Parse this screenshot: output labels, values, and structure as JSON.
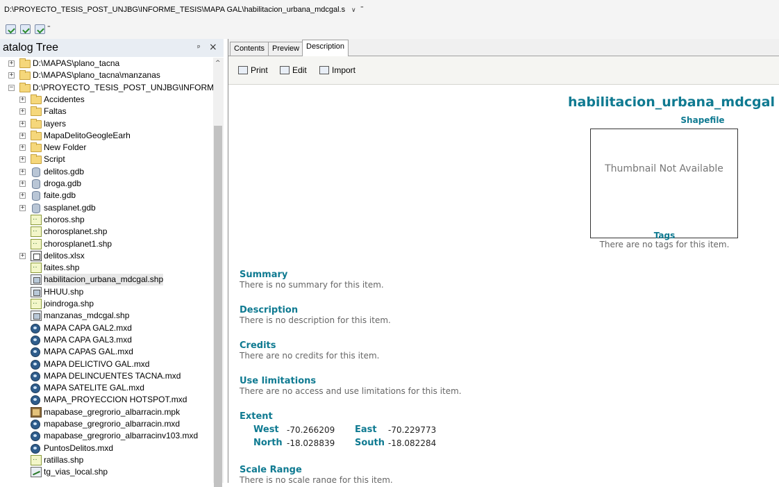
{
  "address_bar": {
    "path": "D:\\PROYECTO_TESIS_POST_UNJBG\\INFORME_TESIS\\MAPA GAL\\habilitacion_urbana_mdcgal.s",
    "dropdown": "∨",
    "more": "⁼"
  },
  "catalog": {
    "title": "atalog Tree",
    "pin": "ᵖ",
    "close": "×",
    "items": [
      {
        "label": "D:\\MAPAS\\plano_tacna",
        "expander": "+",
        "icon": "folder-icon",
        "level": 0
      },
      {
        "label": "D:\\MAPAS\\plano_tacna\\manzanas",
        "expander": "+",
        "icon": "folder-icon",
        "level": 0
      },
      {
        "label": "D:\\PROYECTO_TESIS_POST_UNJBG\\INFORME",
        "expander": "−",
        "icon": "folder-icon",
        "level": 0
      },
      {
        "label": "Accidentes",
        "expander": "+",
        "icon": "folder-icon",
        "level": 1
      },
      {
        "label": "Faltas",
        "expander": "+",
        "icon": "folder-icon",
        "level": 1
      },
      {
        "label": "layers",
        "expander": "+",
        "icon": "folder-icon",
        "level": 1
      },
      {
        "label": "MapaDelitoGeogleEarh",
        "expander": "+",
        "icon": "folder-icon",
        "level": 1
      },
      {
        "label": "New Folder",
        "expander": "+",
        "icon": "folder-icon",
        "level": 1
      },
      {
        "label": "Script",
        "expander": "+",
        "icon": "folder-icon",
        "level": 1
      },
      {
        "label": "delitos.gdb",
        "expander": "+",
        "icon": "gdb-icon",
        "level": 1
      },
      {
        "label": "droga.gdb",
        "expander": "+",
        "icon": "gdb-icon",
        "level": 1
      },
      {
        "label": "faite.gdb",
        "expander": "+",
        "icon": "gdb-icon",
        "level": 1
      },
      {
        "label": "sasplanet.gdb",
        "expander": "+",
        "icon": "gdb-icon",
        "level": 1
      },
      {
        "label": "choros.shp",
        "expander": "",
        "icon": "point-shapefile-icon",
        "level": 1
      },
      {
        "label": "chorosplanet.shp",
        "expander": "",
        "icon": "point-shapefile-icon",
        "level": 1
      },
      {
        "label": "chorosplanet1.shp",
        "expander": "",
        "icon": "point-shapefile-icon",
        "level": 1
      },
      {
        "label": "delitos.xlsx",
        "expander": "+",
        "icon": "table-icon",
        "level": 1
      },
      {
        "label": "faites.shp",
        "expander": "",
        "icon": "point-shapefile-icon",
        "level": 1
      },
      {
        "label": "habilitacion_urbana_mdcgal.shp",
        "expander": "",
        "icon": "polygon-shapefile-icon",
        "level": 1,
        "selected": true
      },
      {
        "label": "HHUU.shp",
        "expander": "",
        "icon": "polygon-shapefile-icon",
        "level": 1
      },
      {
        "label": "joindroga.shp",
        "expander": "",
        "icon": "point-shapefile-icon",
        "level": 1
      },
      {
        "label": "manzanas_mdcgal.shp",
        "expander": "",
        "icon": "polygon-shapefile-icon",
        "level": 1
      },
      {
        "label": "MAPA CAPA GAL2.mxd",
        "expander": "",
        "icon": "map-document-icon",
        "level": 1
      },
      {
        "label": "MAPA CAPA GAL3.mxd",
        "expander": "",
        "icon": "map-document-icon",
        "level": 1
      },
      {
        "label": "MAPA CAPAS GAL.mxd",
        "expander": "",
        "icon": "map-document-icon",
        "level": 1
      },
      {
        "label": "MAPA DELICTIVO GAL.mxd",
        "expander": "",
        "icon": "map-document-icon",
        "level": 1
      },
      {
        "label": "MAPA DELINCUENTES TACNA.mxd",
        "expander": "",
        "icon": "map-document-icon",
        "level": 1
      },
      {
        "label": "MAPA SATELITE GAL.mxd",
        "expander": "",
        "icon": "map-document-icon",
        "level": 1
      },
      {
        "label": "MAPA_PROYECCION HOTSPOT.mxd",
        "expander": "",
        "icon": "map-document-icon",
        "level": 1
      },
      {
        "label": "mapabase_gregrorio_albarracin.mpk",
        "expander": "",
        "icon": "map-package-icon",
        "level": 1
      },
      {
        "label": "mapabase_gregrorio_albarracin.mxd",
        "expander": "",
        "icon": "map-document-icon",
        "level": 1
      },
      {
        "label": "mapabase_gregrorio_albarracinv103.mxd",
        "expander": "",
        "icon": "map-document-icon",
        "level": 1
      },
      {
        "label": "PuntosDelitos.mxd",
        "expander": "",
        "icon": "map-document-icon",
        "level": 1
      },
      {
        "label": "ratillas.shp",
        "expander": "",
        "icon": "point-shapefile-icon",
        "level": 1
      },
      {
        "label": "tg_vias_local.shp",
        "expander": "",
        "icon": "line-shapefile-icon",
        "level": 1
      }
    ],
    "scroll_up": "^"
  },
  "tabs": [
    {
      "label": "Contents",
      "active": false
    },
    {
      "label": "Preview",
      "active": false
    },
    {
      "label": "Description",
      "active": true
    }
  ],
  "actions": {
    "print": "Print",
    "edit": "Edit",
    "import": "Import"
  },
  "description": {
    "title": "habilitacion_urbana_mdcgal",
    "type": "Shapefile",
    "thumbnail_text": "Thumbnail Not Available",
    "tags_heading": "Tags",
    "tags_text": "There are no tags for this item.",
    "summary_heading": "Summary",
    "summary_text": "There is no summary for this item.",
    "description_heading": "Description",
    "description_text": "There is no description for this item.",
    "credits_heading": "Credits",
    "credits_text": "There are no credits for this item.",
    "use_heading": "Use limitations",
    "use_text": "There are no access and use limitations for this item.",
    "extent_heading": "Extent",
    "extent": {
      "west_label": "West",
      "west": "-70.266209",
      "east_label": "East",
      "east": "-70.229773",
      "north_label": "North",
      "north": "-18.028839",
      "south_label": "South",
      "south": "-18.082284"
    },
    "scale_heading": "Scale Range",
    "scale_text": "There is no scale range for this item."
  }
}
